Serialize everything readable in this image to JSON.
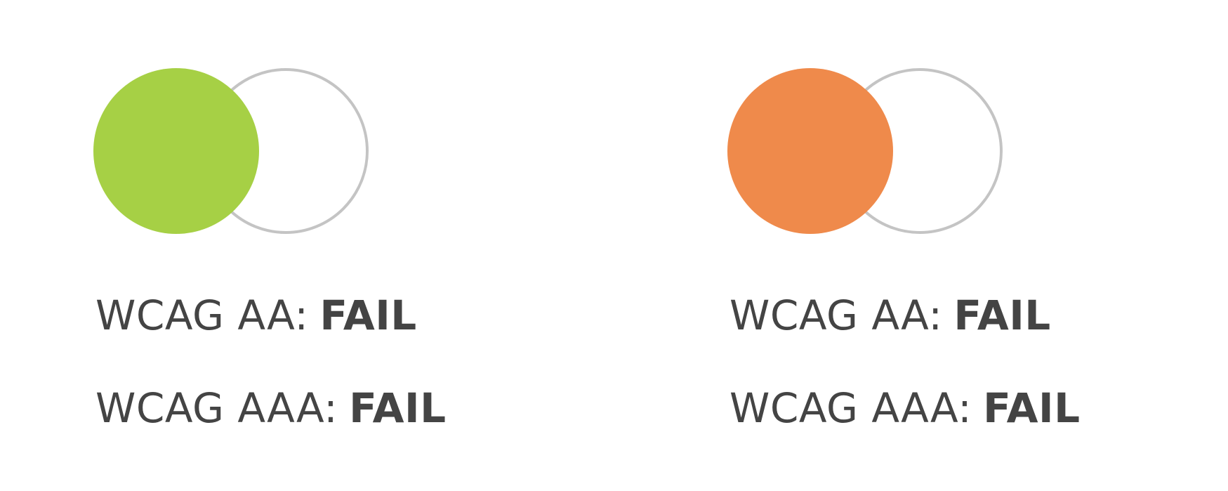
{
  "swatches": [
    {
      "foreground_color": "#a6d045",
      "background_color": "#ffffff",
      "background_border_color": "#c4c4c4",
      "results": {
        "aa": {
          "label": "WCAG AA:",
          "verdict": "FAIL"
        },
        "aaa": {
          "label": "WCAG AAA:",
          "verdict": "FAIL"
        }
      }
    },
    {
      "foreground_color": "#ef8a4b",
      "background_color": "#ffffff",
      "background_border_color": "#c4c4c4",
      "results": {
        "aa": {
          "label": "WCAG AA:",
          "verdict": "FAIL"
        },
        "aaa": {
          "label": "WCAG AAA:",
          "verdict": "FAIL"
        }
      }
    }
  ]
}
